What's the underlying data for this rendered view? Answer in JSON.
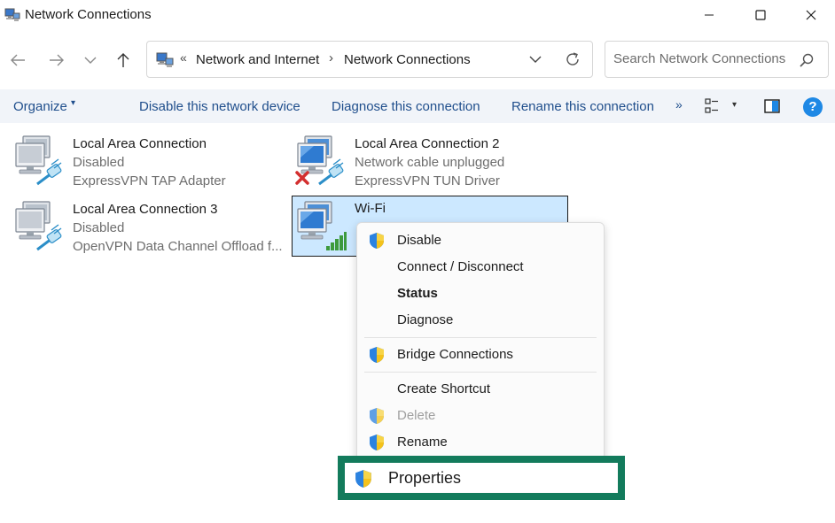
{
  "window": {
    "title": "Network Connections",
    "icon": "network-connections-icon",
    "controls": [
      "minimize-icon",
      "maximize-icon",
      "close-icon"
    ]
  },
  "address": {
    "overflow": "«",
    "crumbs": [
      "Network and Internet",
      "Network Connections"
    ],
    "separator": "›"
  },
  "search": {
    "placeholder": "Search Network Connections"
  },
  "commands": {
    "organize": "Organize",
    "organize_caret": "▾",
    "disable": "Disable this network device",
    "diagnose": "Diagnose this connection",
    "rename": "Rename this connection",
    "more": "»",
    "view_caret": "▾",
    "help": "?"
  },
  "adapters": [
    {
      "name": "Local Area Connection",
      "status": "Disabled",
      "device": "ExpressVPN TAP Adapter",
      "icon": "ethernet-adapter-icon"
    },
    {
      "name": "Local Area Connection 2",
      "status": "Network cable unplugged",
      "device": "ExpressVPN TUN Driver",
      "icon": "ethernet-adapter-error-icon"
    },
    {
      "name": "Local Area Connection 3",
      "status": "Disabled",
      "device": "OpenVPN Data Channel Offload f...",
      "icon": "ethernet-adapter-icon"
    },
    {
      "name": "Wi-Fi",
      "status": "",
      "device": "",
      "icon": "wifi-adapter-icon",
      "selected": true
    }
  ],
  "context_menu": {
    "items": [
      {
        "label": "Disable",
        "shield": true
      },
      {
        "label": "Connect / Disconnect",
        "shield": false
      },
      {
        "label": "Status",
        "shield": false,
        "bold": true
      },
      {
        "label": "Diagnose",
        "shield": false
      },
      {
        "label": "Bridge Connections",
        "shield": true
      },
      {
        "label": "Create Shortcut",
        "shield": false
      },
      {
        "label": "Delete",
        "shield": true,
        "disabled": true
      },
      {
        "label": "Rename",
        "shield": true
      }
    ],
    "highlighted": {
      "label": "Properties",
      "shield": true,
      "frame_color": "#137b5c"
    }
  },
  "colors": {
    "command_text": "#1f4e8c",
    "selection_bg": "#cce8ff",
    "help_badge": "#1e88e5",
    "highlight_frame": "#137b5c"
  }
}
